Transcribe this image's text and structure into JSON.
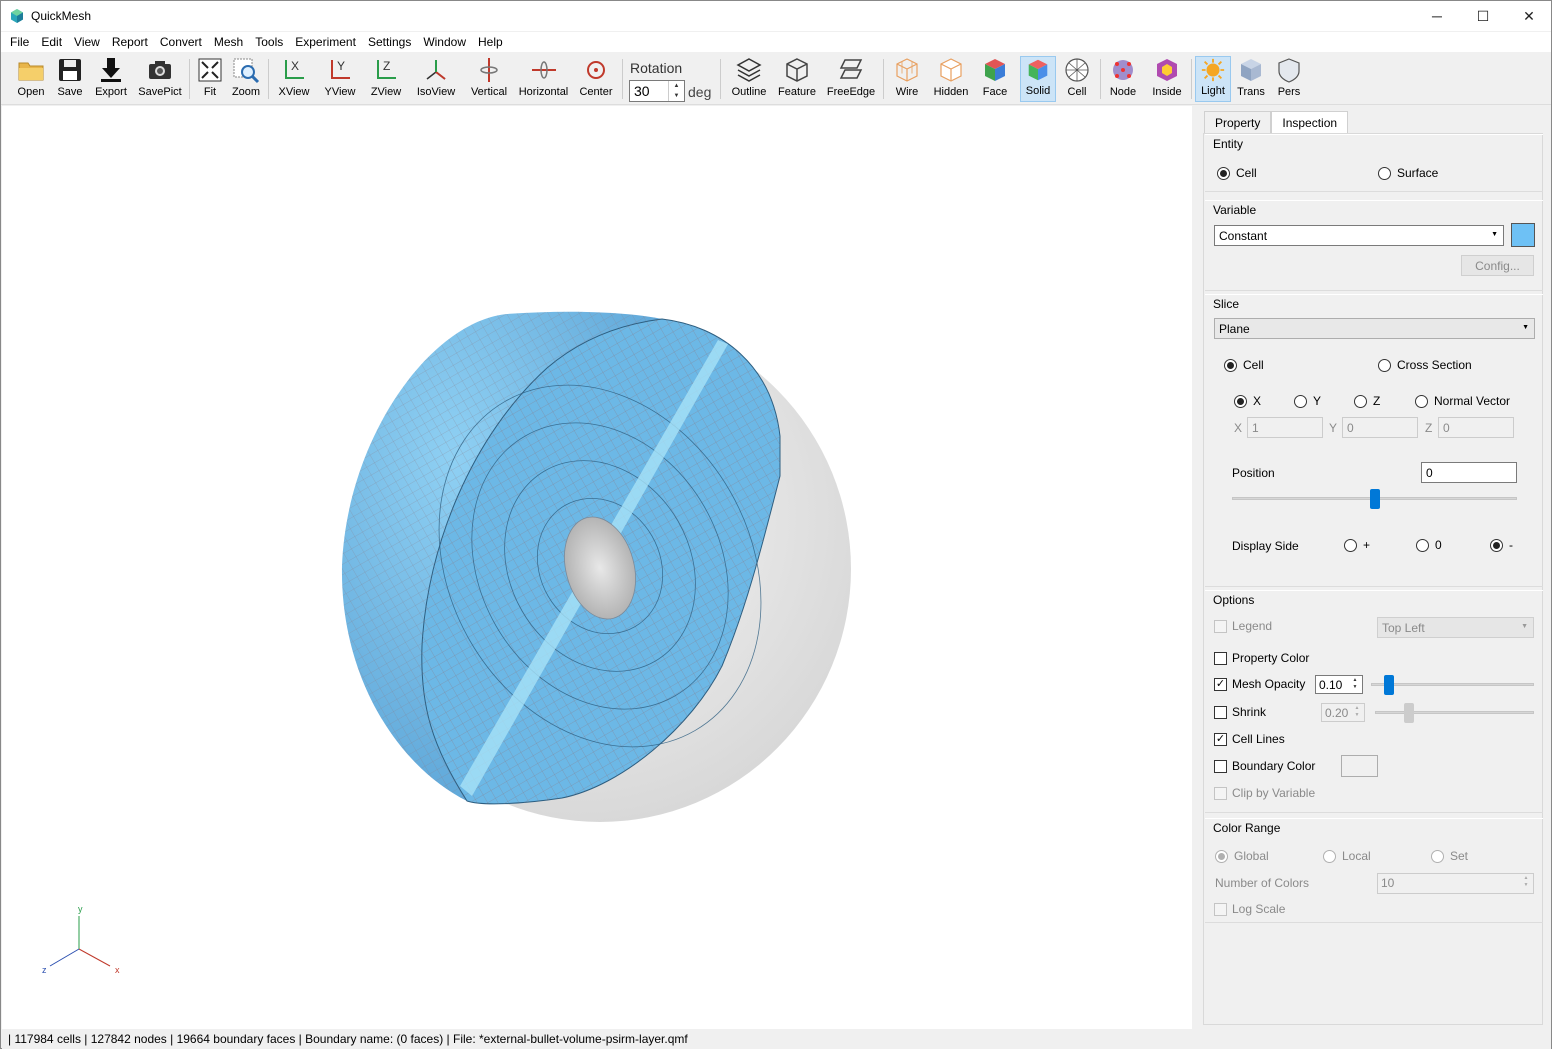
{
  "window": {
    "title": "QuickMesh",
    "minimize": "─",
    "maximize": "☐",
    "close": "✕"
  },
  "menu": [
    "File",
    "Edit",
    "View",
    "Report",
    "Convert",
    "Mesh",
    "Tools",
    "Experiment",
    "Settings",
    "Window",
    "Help"
  ],
  "toolbar": {
    "open": "Open",
    "save": "Save",
    "export": "Export",
    "savepict": "SavePict",
    "fit": "Fit",
    "zoom": "Zoom",
    "xview": "XView",
    "yview": "YView",
    "zview": "ZView",
    "isoview": "IsoView",
    "vertical": "Vertical",
    "horizontal": "Horizontal",
    "center": "Center",
    "rotation_label": "Rotation",
    "rotation_value": "30",
    "rotation_unit": "deg",
    "outline": "Outline",
    "feature": "Feature",
    "freeedge": "FreeEdge",
    "wire": "Wire",
    "hidden": "Hidden",
    "face": "Face",
    "solid": "Solid",
    "cell": "Cell",
    "node": "Node",
    "inside": "Inside",
    "light": "Light",
    "trans": "Trans",
    "pers": "Pers"
  },
  "viewport": {
    "axis_x": "x",
    "axis_y": "y",
    "axis_z": "z",
    "mesh_color": "#6cb8e6",
    "background": "#ffffff"
  },
  "panel": {
    "tabs": [
      "Property",
      "Inspection"
    ],
    "active_tab": "Inspection",
    "entity": {
      "title": "Entity",
      "cell": "Cell",
      "surface": "Surface",
      "selected": "Cell"
    },
    "variable": {
      "title": "Variable",
      "value": "Constant",
      "color": "#6ec1f5",
      "config": "Config..."
    },
    "slice": {
      "title": "Slice",
      "mode": "Plane",
      "cell": "Cell",
      "cross_section": "Cross Section",
      "axis_x": "X",
      "axis_y": "Y",
      "axis_z": "Z",
      "normal_vector": "Normal Vector",
      "vec_x_label": "X",
      "vec_x": "1",
      "vec_y_label": "Y",
      "vec_y": "0",
      "vec_z_label": "Z",
      "vec_z": "0",
      "position_label": "Position",
      "position": "0",
      "display_side_label": "Display Side",
      "side_plus": "+",
      "side_zero": "0",
      "side_minus": "-",
      "slider_level": 0.5
    },
    "options": {
      "title": "Options",
      "legend": "Legend",
      "legend_position": "Top Left",
      "property_color": "Property Color",
      "mesh_opacity": "Mesh Opacity",
      "mesh_opacity_value": "0.10",
      "shrink": "Shrink",
      "shrink_value": "0.20",
      "cell_lines": "Cell Lines",
      "boundary_color": "Boundary Color",
      "clip_by_variable": "Clip by Variable",
      "check_mark": "✓"
    },
    "color_range": {
      "title": "Color Range",
      "global": "Global",
      "local": "Local",
      "set": "Set",
      "number_of_colors_label": "Number of Colors",
      "number_of_colors": "10",
      "log_scale": "Log Scale"
    }
  },
  "status": "| 117984 cells | 127842 nodes | 19664 boundary faces |  Boundary name:  (0 faces) | File: *external-bullet-volume-psirm-layer.qmf"
}
